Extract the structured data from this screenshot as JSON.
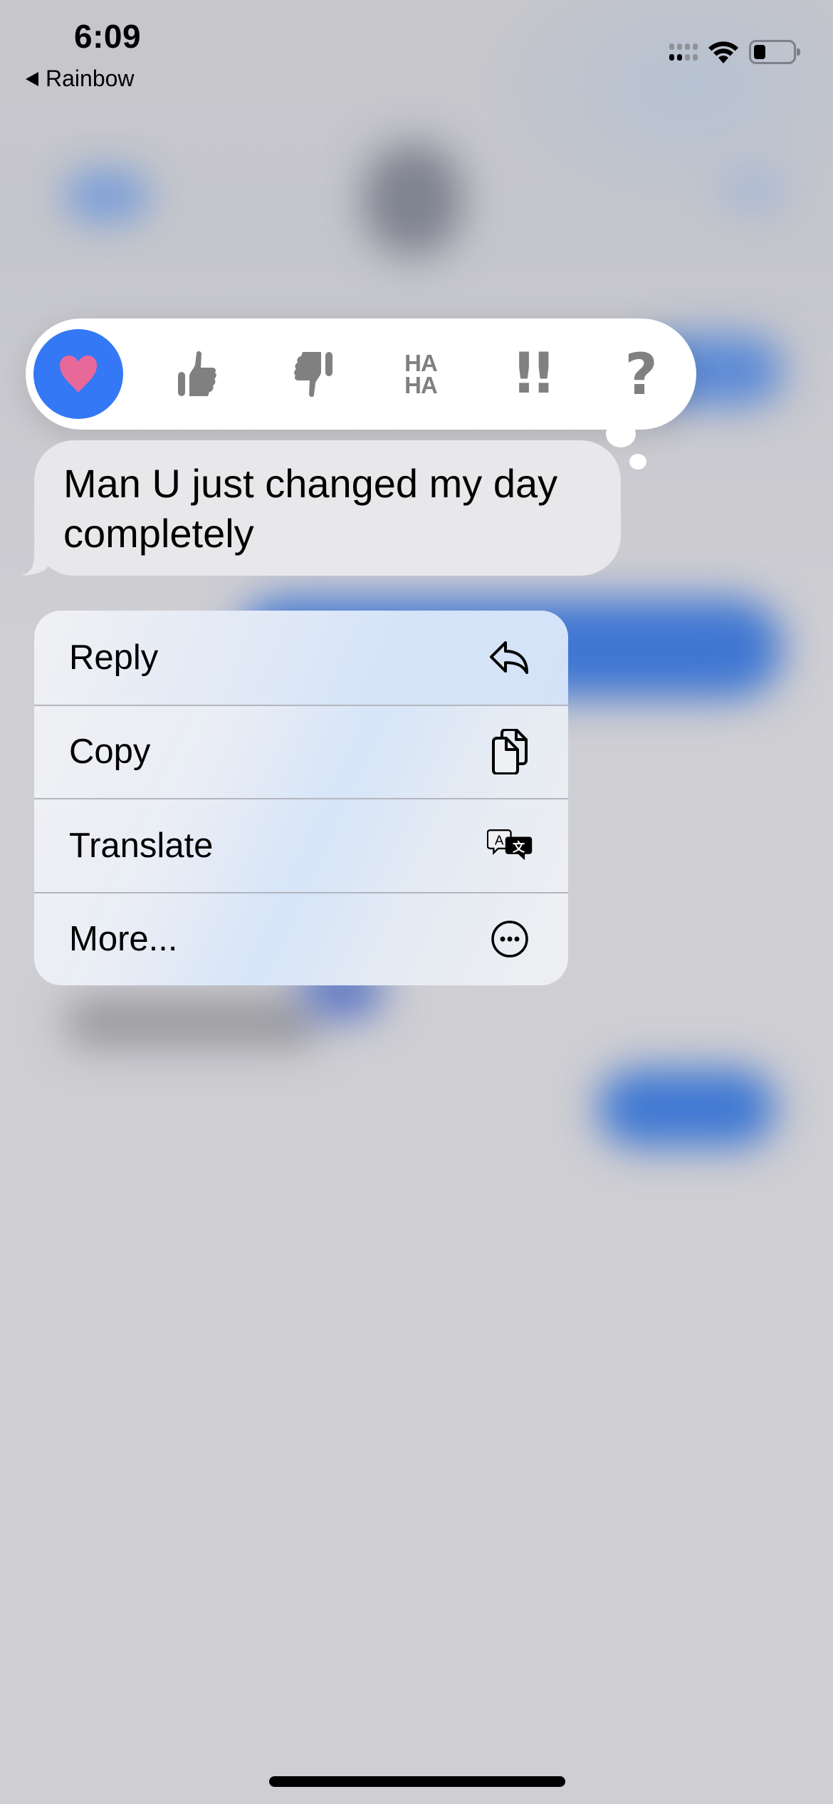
{
  "status_bar": {
    "time": "6:09",
    "back_app": "Rainbow",
    "signal_bars_active": 2,
    "signal_bars_total": 4,
    "wifi": "wifi-icon",
    "battery_level": 0.3
  },
  "tapback": {
    "reactions": [
      {
        "name": "heart",
        "icon": "heart-icon",
        "selected": true,
        "color": "#e8689a",
        "bg": "#3478f6"
      },
      {
        "name": "thumbs-up",
        "icon": "thumbs-up-icon",
        "selected": false
      },
      {
        "name": "thumbs-down",
        "icon": "thumbs-down-icon",
        "selected": false
      },
      {
        "name": "haha",
        "icon": "haha-icon",
        "text_line1": "HA",
        "text_line2": "HA",
        "selected": false
      },
      {
        "name": "emphasize",
        "icon": "exclamation-icon",
        "text": "!!",
        "selected": false
      },
      {
        "name": "question",
        "icon": "question-icon",
        "text": "?",
        "selected": false
      }
    ],
    "icon_color": "#808080"
  },
  "message": {
    "text": "Man U just changed my day completely",
    "direction": "incoming"
  },
  "context_menu": {
    "items": [
      {
        "label": "Reply",
        "icon": "reply-icon"
      },
      {
        "label": "Copy",
        "icon": "copy-icon"
      },
      {
        "label": "Translate",
        "icon": "translate-icon"
      },
      {
        "label": "More...",
        "icon": "ellipsis-circle-icon"
      }
    ]
  },
  "colors": {
    "accent_blue": "#3478f6",
    "heart_pink": "#e8689a",
    "incoming_bubble": "#e8e8ea",
    "background": "#cfced3"
  }
}
